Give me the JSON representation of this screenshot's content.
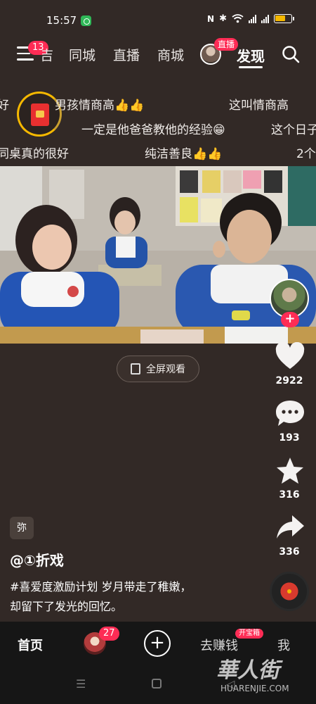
{
  "status_bar": {
    "time": "15:57"
  },
  "top_nav": {
    "menu_badge": "13",
    "partial_tab": "吉",
    "tabs": [
      "同城",
      "直播",
      "商城"
    ],
    "live_badge": "直播",
    "active_tab": "发现"
  },
  "danmaku": {
    "row1": [
      "好",
      "男孩情商高👍👍",
      "这叫情商高"
    ],
    "row2": [
      "一定是他爸爸教他的经验😁",
      "这个日子"
    ],
    "row3": [
      "同桌真的很好",
      "纯洁善良👍👍",
      "2个"
    ]
  },
  "fullscreen_button": "全屏观看",
  "right_rail": {
    "likes": "2922",
    "comments": "193",
    "favorites": "316",
    "shares": "336"
  },
  "post": {
    "tag_chip": "弥",
    "author": "@①折戏",
    "caption_line1": "#喜爱度激励计划 岁月带走了稚嫩，",
    "caption_line2": "却留下了发光的回忆。"
  },
  "bottom_tabs": {
    "home": "首页",
    "friends_badge": "27",
    "earn": "去赚钱",
    "earn_badge": "开宝箱",
    "me": "我"
  },
  "watermark": {
    "brand_cn": "華人街",
    "brand_en": "HUARENJIE.COM"
  },
  "colors": {
    "accent": "#fe2c55",
    "background": "#322926",
    "tabbar": "#161616"
  }
}
